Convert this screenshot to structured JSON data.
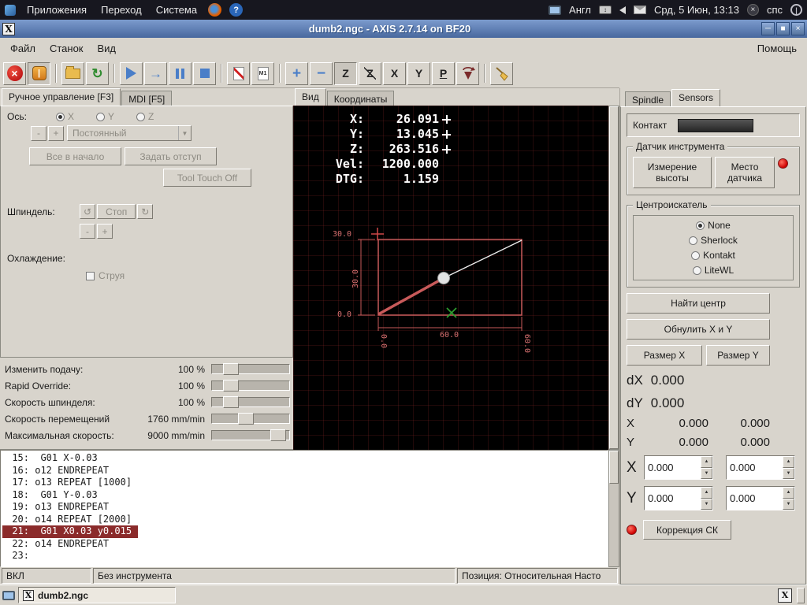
{
  "desktop_panel": {
    "menus": [
      {
        "label": "Приложения"
      },
      {
        "label": "Переход"
      },
      {
        "label": "Система"
      }
    ],
    "language": "Англ",
    "clock": "Срд, 5 Июн, 13:13",
    "tray_label": "спс"
  },
  "titlebar": {
    "title": "dumb2.ngc - AXIS 2.7.14 on BF20"
  },
  "menubar": {
    "items": [
      {
        "label": "Файл"
      },
      {
        "label": "Станок"
      },
      {
        "label": "Вид"
      }
    ],
    "help_label": "Помощь"
  },
  "toolbar": {
    "icons": [
      "estop-icon",
      "machine-power-icon",
      "open-file-icon",
      "reload-icon",
      "run-icon",
      "step-icon",
      "pause-icon",
      "stop-icon",
      "block-delete-icon",
      "optional-stop-icon",
      "zoom-in-icon",
      "zoom-out-icon",
      "view-top-icon",
      "view-rotated-top-icon",
      "view-side-icon",
      "view-front-icon",
      "view-perspective-icon",
      "rotate-view-icon",
      "clear-plot-icon"
    ],
    "m1_label": "M1"
  },
  "manual_tab": {
    "tabs": [
      {
        "label": "Ручное управление [F3]"
      },
      {
        "label": "MDI [F5]"
      }
    ],
    "axis_label": "Ось:",
    "axis_options": [
      {
        "label": "X"
      },
      {
        "label": "Y"
      },
      {
        "label": "Z"
      }
    ],
    "jog_minus": "-",
    "jog_plus": "+",
    "increment_value": "Постоянный",
    "home_all": "Все в начало",
    "touch_off": "Задать отступ",
    "tool_touch_off": "Tool Touch Off",
    "spindle_label": "Шпиндель:",
    "spindle_stop": "Стоп",
    "spindle_minus": "-",
    "spindle_plus": "+",
    "coolant_label": "Охлаждение:",
    "mist_label": "Струя"
  },
  "overrides": {
    "rows": [
      {
        "label": "Изменить подачу:",
        "value": "100 %"
      },
      {
        "label": "Rapid Override:",
        "value": "100 %"
      },
      {
        "label": "Скорость шпинделя:",
        "value": "100 %"
      },
      {
        "label": "Скорость перемещений",
        "value": "1760 mm/min"
      },
      {
        "label": "Максимальная скорость:",
        "value": "9000 mm/min"
      }
    ]
  },
  "preview": {
    "tabs": [
      {
        "label": "Вид"
      },
      {
        "label": "Координаты"
      }
    ],
    "dro": [
      {
        "label": "X:",
        "value": "26.091"
      },
      {
        "label": "Y:",
        "value": "13.045"
      },
      {
        "label": "Z:",
        "value": "263.516"
      },
      {
        "label": "Vel:",
        "value": "1200.000"
      },
      {
        "label": "DTG:",
        "value": "1.159"
      }
    ],
    "dimensions": {
      "height_top": "30.0",
      "height_mid": "30.0",
      "height_bottom": "0.0",
      "width_left": "0.0",
      "width_mid": "60.0",
      "width_right": "60.0"
    }
  },
  "gcode": {
    "lines": [
      {
        "num": "15:",
        "text": "  G01 X-0.03"
      },
      {
        "num": "16:",
        "text": " o12 ENDREPEAT"
      },
      {
        "num": "17:",
        "text": " o13 REPEAT [1000]"
      },
      {
        "num": "18:",
        "text": "  G01 Y-0.03"
      },
      {
        "num": "19:",
        "text": " o13 ENDREPEAT"
      },
      {
        "num": "20:",
        "text": " o14 REPEAT [2000]"
      },
      {
        "num": "21:",
        "text": "  G01 X0.03 y0.015"
      },
      {
        "num": "22:",
        "text": " o14 ENDREPEAT"
      },
      {
        "num": "23:",
        "text": ""
      }
    ]
  },
  "statusbar": {
    "machine_state": "ВКЛ",
    "tool": "Без инструмента",
    "position": "Позиция: Относительная Насто"
  },
  "sensors": {
    "tabs": [
      {
        "label": "Spindle"
      },
      {
        "label": "Sensors"
      }
    ],
    "contact_label": "Контакт",
    "tool_sensor_title": "Датчик инструмента",
    "measure_height": "Измерение высоты",
    "sensor_place": "Место датчика",
    "center_finder_title": "Центроискатель",
    "finder_options": [
      {
        "label": "None"
      },
      {
        "label": "Sherlock"
      },
      {
        "label": "Kontakt"
      },
      {
        "label": "LiteWL"
      }
    ],
    "find_center": "Найти центр",
    "zero_xy": "Обнулить X и Y",
    "size_x": "Размер X",
    "size_y": "Размер Y",
    "dx_label": "dX",
    "dx_value": "0.000",
    "dy_label": "dY",
    "dy_value": "0.000",
    "x_label": "X",
    "x_value1": "0.000",
    "x_value2": "0.000",
    "y_label": "Y",
    "y_value1": "0.000",
    "y_value2": "0.000",
    "x_spin1": "0.000",
    "x_spin2": "0.000",
    "y_spin1": "0.000",
    "y_spin2": "0.000",
    "correction": "Коррекция СК"
  },
  "taskbar": {
    "window_label": "dumb2.ngc"
  },
  "window_icon_letter": "X"
}
